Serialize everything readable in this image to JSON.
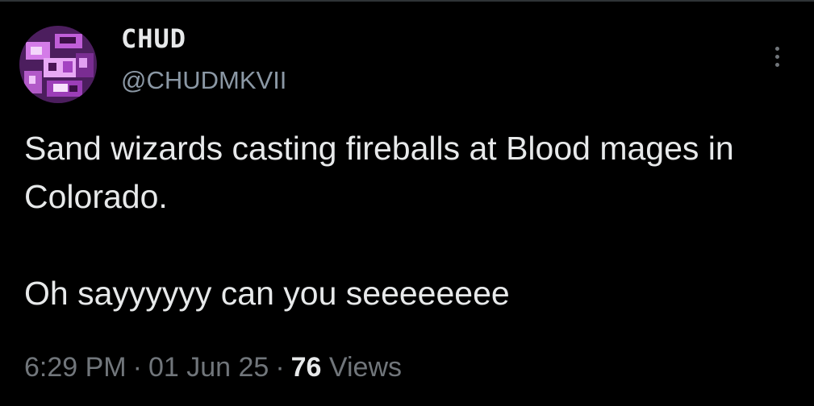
{
  "tweet": {
    "author": {
      "display_name": "CHUD",
      "handle": "@CHUDMKVII",
      "avatar": "profile-avatar-purple"
    },
    "text_lines": [
      "Sand wizards casting fireballs at Blood mages in Colorado."
    ],
    "text_line_2": "Oh sayyyyyy can you seeeeeeee",
    "time": "6:29 PM",
    "separator": "·",
    "date": "01 Jun 25",
    "views_count": "76",
    "views_label": "Views",
    "more_icon": "more-vertical-icon"
  },
  "colors": {
    "background": "#000000",
    "text_primary": "#e7e9ea",
    "text_secondary": "#71767b",
    "avatar_accent": "#b25ac8"
  }
}
